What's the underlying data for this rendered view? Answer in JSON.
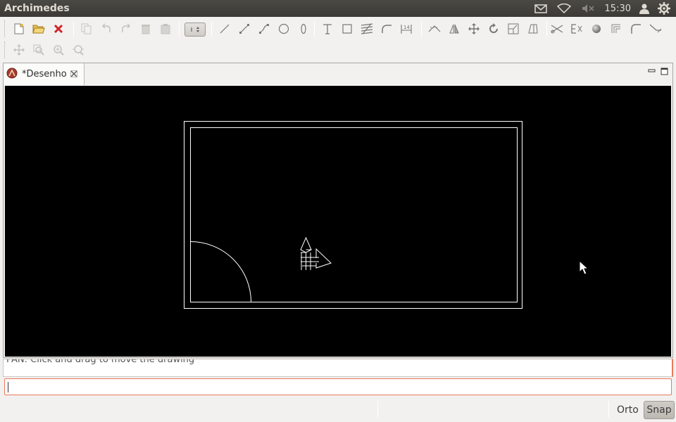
{
  "panel": {
    "app_title": "Archimedes",
    "clock": "15:30",
    "indicators": [
      "mail-icon",
      "wifi-icon",
      "volume-muted-icon",
      "user-icon",
      "power-gear-icon"
    ]
  },
  "toolbar": {
    "row1": [
      "new-file-icon",
      "open-folder-icon",
      "close-red-icon",
      "copy-icon",
      "undo-icon",
      "redo-icon",
      "delete-icon",
      "paste-icon",
      "line-icon",
      "polyline-icon",
      "arc-polyline-icon",
      "circle-icon",
      "ellipse-icon",
      "text-icon",
      "rectangle-icon",
      "hatch-icon",
      "fillet-arc-icon",
      "dimension-icon",
      "trim-icon",
      "mirror-icon",
      "move-icon",
      "rotate-icon",
      "scale-icon",
      "stretch-icon",
      "cut-icon",
      "explode-icon",
      "sphere-icon",
      "offset-icon",
      "fillet-icon",
      "extend-icon"
    ],
    "row2": [
      "pan-icon",
      "zoom-window-icon",
      "zoom-in-icon",
      "zoom-extents-icon"
    ]
  },
  "editor": {
    "tab_label": "*Desenho",
    "tab_icon": "archimedes-app-icon",
    "minimize_icon": "minimize-icon",
    "maximize_icon": "maximize-icon"
  },
  "console": {
    "message": "PAN: Click and drag to move the drawing",
    "command_value": ""
  },
  "status": {
    "orto_label": "Orto",
    "snap_label": "Snap"
  },
  "colors": {
    "canvas_bg": "#000000",
    "drawing_lines": "#ffffff",
    "input_border": "#e9795a",
    "panel_bg": "#3c3b37"
  }
}
